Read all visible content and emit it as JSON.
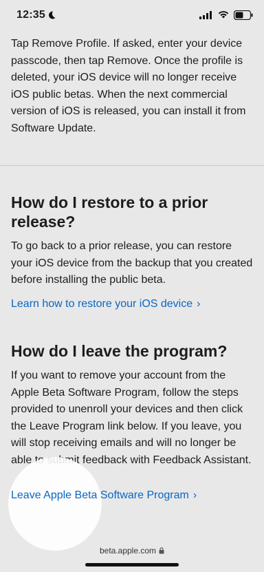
{
  "status": {
    "time": "12:35",
    "icons": [
      "moon-icon",
      "signal-icon",
      "wifi-icon",
      "battery-icon"
    ]
  },
  "intro": {
    "text": "Tap Remove Profile. If asked, enter your device passcode, then tap Remove. Once the profile is deleted, your iOS device will no longer receive iOS public betas. When the next commercial version of iOS is released, you can install it from Software Update."
  },
  "sections": [
    {
      "heading": "How do I restore to a prior release?",
      "body": "To go back to a prior release, you can restore your iOS device from the backup that you created before installing the public beta.",
      "link": "Learn how to restore your iOS device"
    },
    {
      "heading": "How do I leave the program?",
      "body": "If you want to remove your account from the Apple Beta Software Program, follow the steps provided to unenroll your devices and then click the Leave Program link below. If you leave, you will stop receiving emails and will no longer be able to submit feedback with Feedback Assistant.",
      "link": "Leave Apple Beta Software Program"
    }
  ],
  "link_chevron": "›",
  "url_bar": {
    "domain": "beta.apple.com"
  },
  "colors": {
    "background": "#e8e8e8",
    "link": "#0a66c2",
    "text": "#1d1d1f"
  }
}
